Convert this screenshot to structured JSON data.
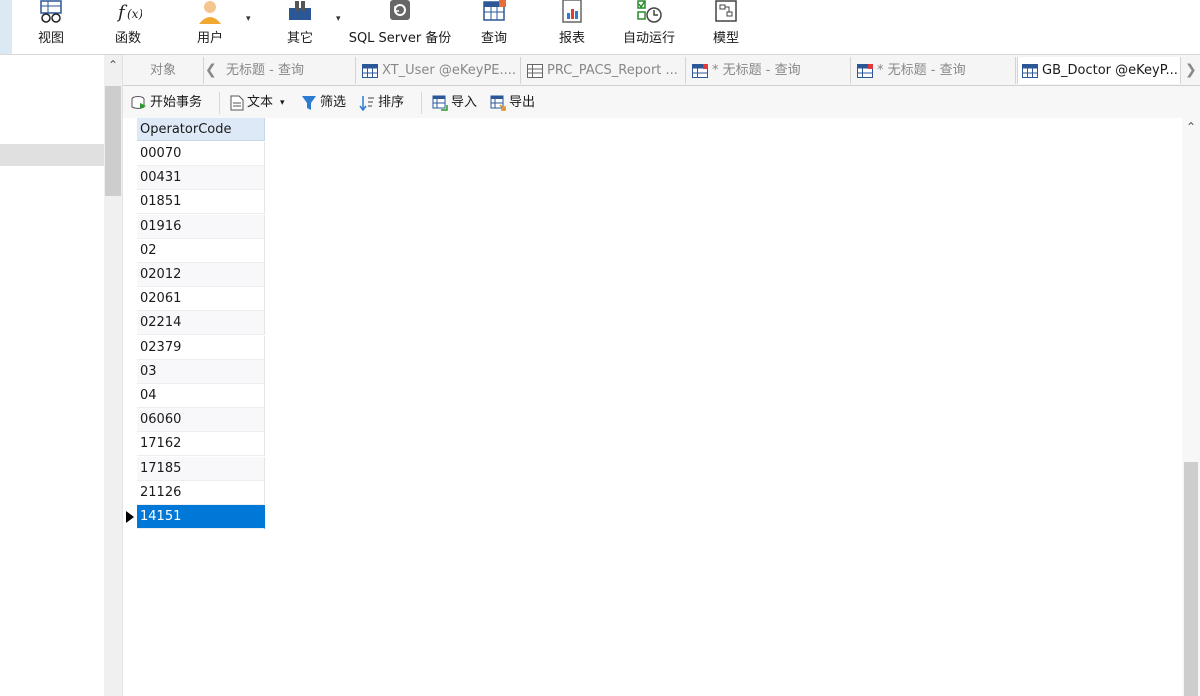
{
  "ribbon": {
    "buttons": [
      {
        "label": "视图",
        "icon": "view-icon"
      },
      {
        "label": "函数",
        "icon": "function-icon"
      },
      {
        "label": "用户",
        "icon": "user-icon"
      },
      {
        "label": "其它",
        "icon": "other-icon"
      },
      {
        "label": "SQL Server 备份",
        "icon": "backup-icon"
      },
      {
        "label": "查询",
        "icon": "query-icon"
      },
      {
        "label": "报表",
        "icon": "report-icon"
      },
      {
        "label": "自动运行",
        "icon": "automation-icon"
      },
      {
        "label": "模型",
        "icon": "model-icon"
      }
    ]
  },
  "tabs": [
    {
      "label": "对象"
    },
    {
      "label": "无标题 - 查询"
    },
    {
      "label": "XT_User @eKeyPE...."
    },
    {
      "label": "PRC_PACS_Report ..."
    },
    {
      "label": "* 无标题 - 查询"
    },
    {
      "label": "* 无标题 - 查询"
    },
    {
      "label": "GB_Doctor @eKeyP..."
    }
  ],
  "subtoolbar": {
    "begin_transaction": "开始事务",
    "text": "文本",
    "filter": "筛选",
    "sort": "排序",
    "import": "导入",
    "export": "导出"
  },
  "grid": {
    "column_header": "OperatorCode",
    "rows": [
      "00070",
      "00431",
      "01851",
      "01916",
      "02",
      "02012",
      "02061",
      "02214",
      "02379",
      "03",
      "04",
      "06060",
      "17162",
      "17185",
      "21126",
      "14151"
    ],
    "selected_index": 15
  },
  "colors": {
    "selection": "#0078d7",
    "header": "#dde9f6"
  }
}
